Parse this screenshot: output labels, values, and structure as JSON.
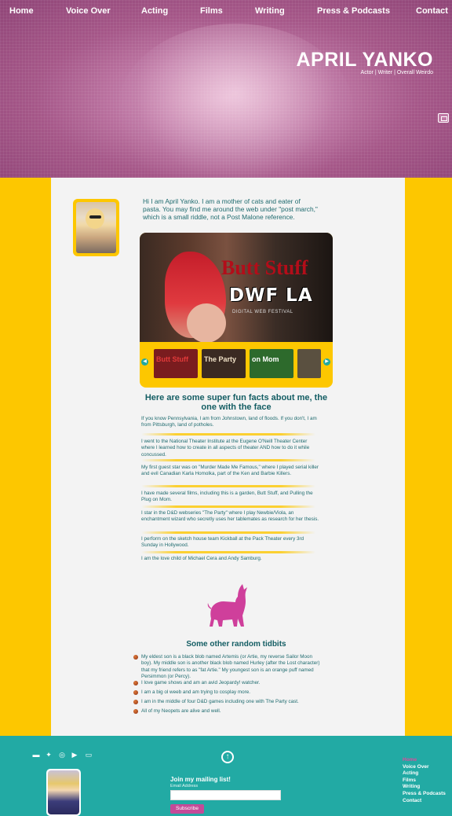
{
  "nav": {
    "items": [
      {
        "label": "Home"
      },
      {
        "label": "Voice Over"
      },
      {
        "label": "Acting"
      },
      {
        "label": "Films"
      },
      {
        "label": "Writing"
      },
      {
        "label": "Press & Podcasts"
      },
      {
        "label": "Contact"
      }
    ]
  },
  "hero": {
    "title": "APRIL YANKO",
    "subtitle": "Actor | Writer | Overall Weirdo"
  },
  "intro": {
    "text": "Hi I am April Yanko. I am a mother of cats and eater of pasta. You may find me around the web under \"post march,\" which is a small riddle, not a Post Malone reference."
  },
  "slider": {
    "main_title": "Butt Stuff",
    "main_logo": "DWF LA",
    "main_tag": "DIGITAL WEB FESTIVAL",
    "thumbs": [
      {
        "label": "Butt Stuff",
        "color": "#7a1c1f"
      },
      {
        "label": "The Party",
        "color": "#3a2a22"
      },
      {
        "label": "on Mom",
        "color": "#2d6a2c"
      },
      {
        "label": "",
        "color": "#5a5040"
      }
    ]
  },
  "facts": {
    "heading": "Here are some super fun facts about me, the one with the face",
    "items": [
      "If you know Pennsylvania, I am from Johnstown, land of floods. If you don't, I am from Pittsburgh, land of potholes.",
      "I went to the National Theater Institute at the Eugene O'Neill Theater Center where I learned how to create in all aspects of theater AND how to do it while concussed.",
      "My first guest star was on \"Murder Made Me Famous,\" where I played serial killer and evil Canadian Karla Homolka, part of the Ken and Barbie Killers.",
      "I have made several films, including this is a garden, Butt Stuff, and Pulling the Plug on Mom.",
      "I star in the D&D webseries \"The Party\" where I play Newbie/Viola, an enchantment wizard who secretly uses her tablemates as research for her thesis.",
      "I perform on the sketch house team Kickball at the Pack Theater every 3rd Sunday in Hollywood.",
      "I am the love child of Michael Cera and Andy Samburg."
    ]
  },
  "tidbits": {
    "heading": "Some other random tidbits",
    "items": [
      "My eldest son is a black blob named Artemis (or Artie, my reverse Sailor Moon boy). My middle son is another black blob named Hurley (after the Lost character) that my friend refers to as \"fat Artie.\" My youngest son is an orange puff named Persimmon (or Percy).",
      "I love game shows and am an avid Jeopardy! watcher.",
      "I am a big ol weeb and am trying to cosplay more.",
      "I am in the middle of four D&D games including one with The Party cast.",
      "All of my Neopets are alive and well."
    ]
  },
  "footer": {
    "mailing_title": "Join my mailing list!",
    "email_label": "Email Address",
    "email_placeholder": "",
    "subscribe_label": "Subscribe",
    "nav": [
      "Home",
      "Voice Over",
      "Acting",
      "Films",
      "Writing",
      "Press & Podcasts",
      "Contact"
    ],
    "social_icons": [
      "imdb-icon",
      "twitter-icon",
      "instagram-icon",
      "youtube-icon",
      "backstage-icon"
    ]
  },
  "colors": {
    "hero_pink": "#a55788",
    "yellow": "#fdc700",
    "teal": "#22aaa4",
    "text_teal": "#1f6b6f",
    "magenta": "#c44a98"
  }
}
